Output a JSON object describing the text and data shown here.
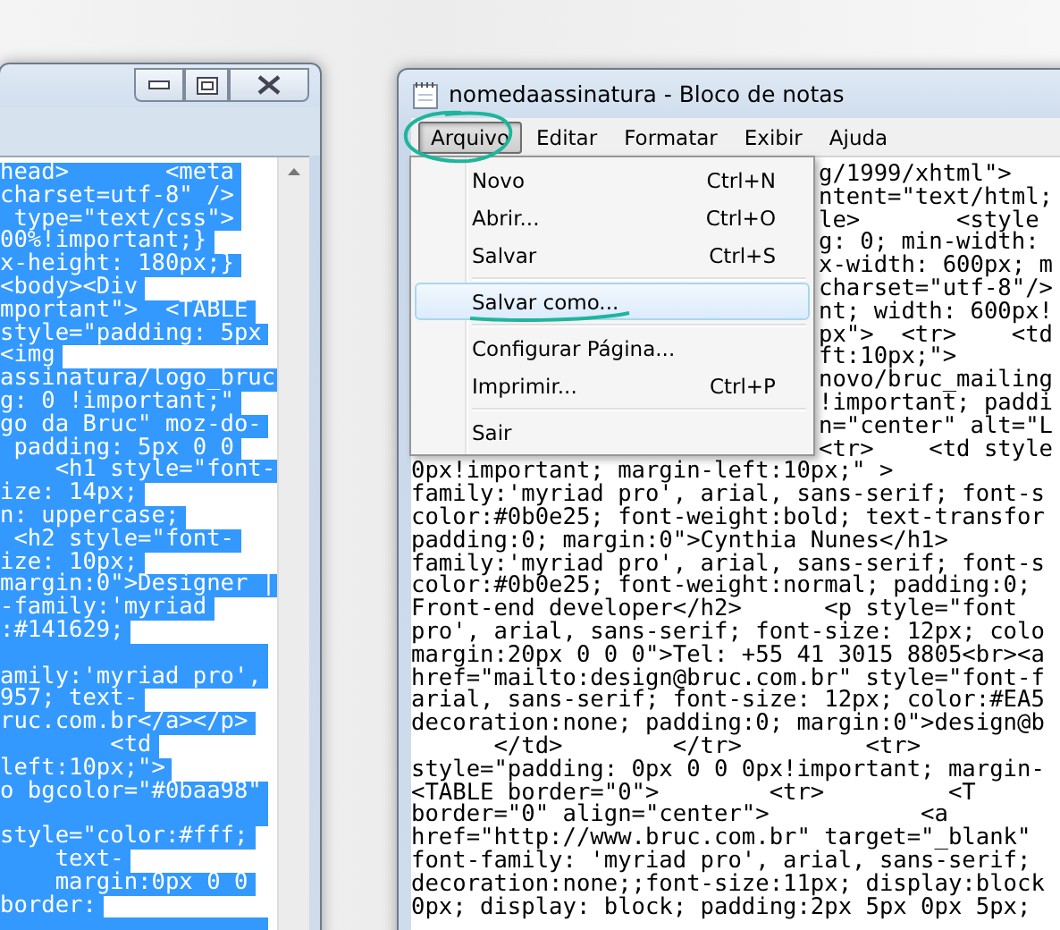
{
  "left_window": {
    "text_selected": true,
    "lines": [
      {
        "kind": "text",
        "text": "head>       <meta"
      },
      {
        "kind": "text",
        "text": "charset=utf-8\" />"
      },
      {
        "kind": "text",
        "text": " type=\"text/css\">"
      },
      {
        "kind": "text",
        "text": "00%!important;}"
      },
      {
        "kind": "text",
        "text": "x-height: 180px;}"
      },
      {
        "kind": "text",
        "text": "<body><Div"
      },
      {
        "kind": "text",
        "text": "mportant\">  <TABLE"
      },
      {
        "kind": "text",
        "text": "style=\"padding: 5px"
      },
      {
        "kind": "text",
        "text": "<img"
      },
      {
        "kind": "text",
        "text": "assinatura/logo_bruc"
      },
      {
        "kind": "text",
        "text": "g: 0 !important;\""
      },
      {
        "kind": "text",
        "text": "go da Bruc\" moz-do-"
      },
      {
        "kind": "text",
        "text": " padding: 5px 0 0"
      },
      {
        "kind": "text",
        "text": "    <h1 style=\"font-"
      },
      {
        "kind": "text",
        "text": "ize: 14px;"
      },
      {
        "kind": "text",
        "text": "n: uppercase;"
      },
      {
        "kind": "text",
        "text": " <h2 style=\"font-"
      },
      {
        "kind": "text",
        "text": "ize: 10px;"
      },
      {
        "kind": "text",
        "text": "margin:0\">Designer |"
      },
      {
        "kind": "text",
        "text": "-family:'myriad"
      },
      {
        "kind": "text",
        "text": ":#141629;"
      },
      {
        "kind": "blank"
      },
      {
        "kind": "text",
        "text": "amily:'myriad pro',"
      },
      {
        "kind": "text",
        "text": "957; text-"
      },
      {
        "kind": "text",
        "text": "ruc.com.br</a></p>"
      },
      {
        "kind": "text",
        "text": "        <td"
      },
      {
        "kind": "text",
        "text": "left:10px;\">"
      },
      {
        "kind": "text",
        "text": "o bgcolor=\"#0baa98\""
      },
      {
        "kind": "blank"
      },
      {
        "kind": "text",
        "text": "style=\"color:#fff;"
      },
      {
        "kind": "text",
        "text": "    text-"
      },
      {
        "kind": "text",
        "text": "    margin:0px 0 0"
      },
      {
        "kind": "text",
        "text": "border:"
      },
      {
        "kind": "blank"
      }
    ]
  },
  "right_window": {
    "title": "nomedaassinatura - Bloco de notas",
    "menu": [
      {
        "label": "Arquivo",
        "selected": true
      },
      {
        "label": "Editar",
        "selected": false
      },
      {
        "label": "Formatar",
        "selected": false
      },
      {
        "label": "Exibir",
        "selected": false
      },
      {
        "label": "Ajuda",
        "selected": false
      }
    ],
    "file_menu": [
      {
        "kind": "item",
        "label": "Novo",
        "shortcut": "Ctrl+N",
        "selected": false
      },
      {
        "kind": "item",
        "label": "Abrir...",
        "shortcut": "Ctrl+O",
        "selected": false
      },
      {
        "kind": "item",
        "label": "Salvar",
        "shortcut": "Ctrl+S",
        "selected": false
      },
      {
        "kind": "separator"
      },
      {
        "kind": "item",
        "label": "Salvar como...",
        "selected": true
      },
      {
        "kind": "separator"
      },
      {
        "kind": "item",
        "label": "Configurar Página...",
        "selected": false
      },
      {
        "kind": "item",
        "label": "Imprimir...",
        "shortcut": "Ctrl+P",
        "selected": false
      },
      {
        "kind": "separator"
      },
      {
        "kind": "item",
        "label": "Sair",
        "selected": false
      }
    ],
    "lines_beside_menu": [
      "g/1999/xhtml\">",
      "ntent=\"text/html;",
      "le>       <style",
      "g: 0; min-width:",
      "x-width: 600px; m",
      "charset=\"utf-8\"/>",
      "nt; width: 600px!",
      "px\">  <tr>    <td",
      "ft:10px;\">",
      "novo/bruc_mailing",
      "!important; paddi",
      "n=\"center\" alt=\"L",
      "<tr>    <td style"
    ],
    "lines": [
      "0px!important; margin-left:10px;\" >",
      "family:'myriad pro', arial, sans-serif; font-s",
      "color:#0b0e25; font-weight:bold; text-transfor",
      "padding:0; margin:0\">Cynthia Nunes</h1>",
      "family:'myriad pro', arial, sans-serif; font-s",
      "color:#0b0e25; font-weight:normal; padding:0;",
      "Front-end developer</h2>      <p style=\"font",
      "pro', arial, sans-serif; font-size: 12px; colo",
      "margin:20px 0 0 0\">Tel: +55 41 3015 8805<br><a",
      "href=\"mailto:design@bruc.com.br\" style=\"font-f",
      "arial, sans-serif; font-size: 12px; color:#EA5",
      "decoration:none; padding:0; margin:0\">design@b",
      "      </td>        </tr>         <tr>",
      "style=\"padding: 0px 0 0 0px!important; margin-",
      "<TABLE border=\"0\">        <tr>         <T",
      "border=\"0\" align=\"center\">           <a",
      "href=\"http://www.bruc.com.br\" target=\"_blank\"",
      "font-family: 'myriad pro', arial, sans-serif;",
      "decoration:none;;font-size:11px; display:block",
      "0px; display: block; padding:2px 5px 0px 5px;"
    ]
  }
}
